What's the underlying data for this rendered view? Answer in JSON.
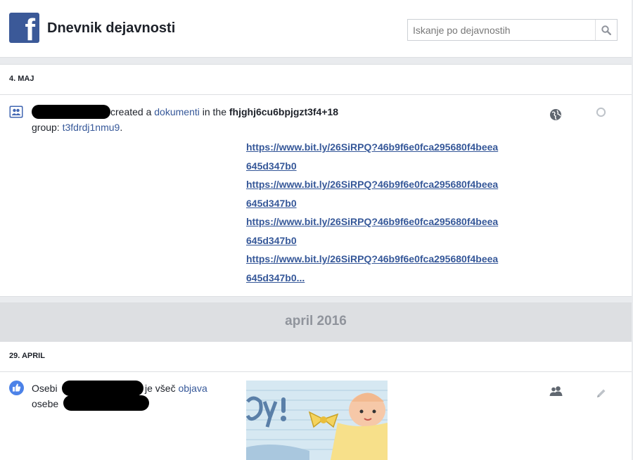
{
  "header": {
    "logo_letter": "f",
    "title": "Dnevnik dejavnosti",
    "search_placeholder": "Iskanje po dejavnostih"
  },
  "sections": [
    {
      "date": "4. MAJ",
      "entry": {
        "text_created": "created a ",
        "link_document": "dokumenti",
        "text_in_the": " in the ",
        "group_name": "fhjghj6cu6bpjgzt3f4+18",
        "text_group": "group: ",
        "group_link": "t3fdrdj1nmu9",
        "text_period": ".",
        "links": [
          "https://www.bit.ly/26SiRPQ?46b9f6e0fca295680f4beea",
          "645d347b0",
          "https://www.bit.ly/26SiRPQ?46b9f6e0fca295680f4beea",
          "645d347b0",
          "https://www.bit.ly/26SiRPQ?46b9f6e0fca295680f4beea",
          "645d347b0",
          "https://www.bit.ly/26SiRPQ?46b9f6e0fca295680f4beea",
          "645d347b0..."
        ],
        "privacy_icon": "globe-icon",
        "action_icon": "circle-icon"
      }
    },
    {
      "month": "april 2016"
    },
    {
      "date": "29. APRIL",
      "entry": {
        "text_osebi": "Osebi",
        "text_likes": "je všeč ",
        "link_post": "objava",
        "text_osebe": "osebe",
        "privacy_icon": "friends-icon",
        "action_icon": "pencil-icon"
      }
    }
  ],
  "colors": {
    "brand": "#3b5998",
    "link": "#365899",
    "background": "#e9ebee"
  }
}
